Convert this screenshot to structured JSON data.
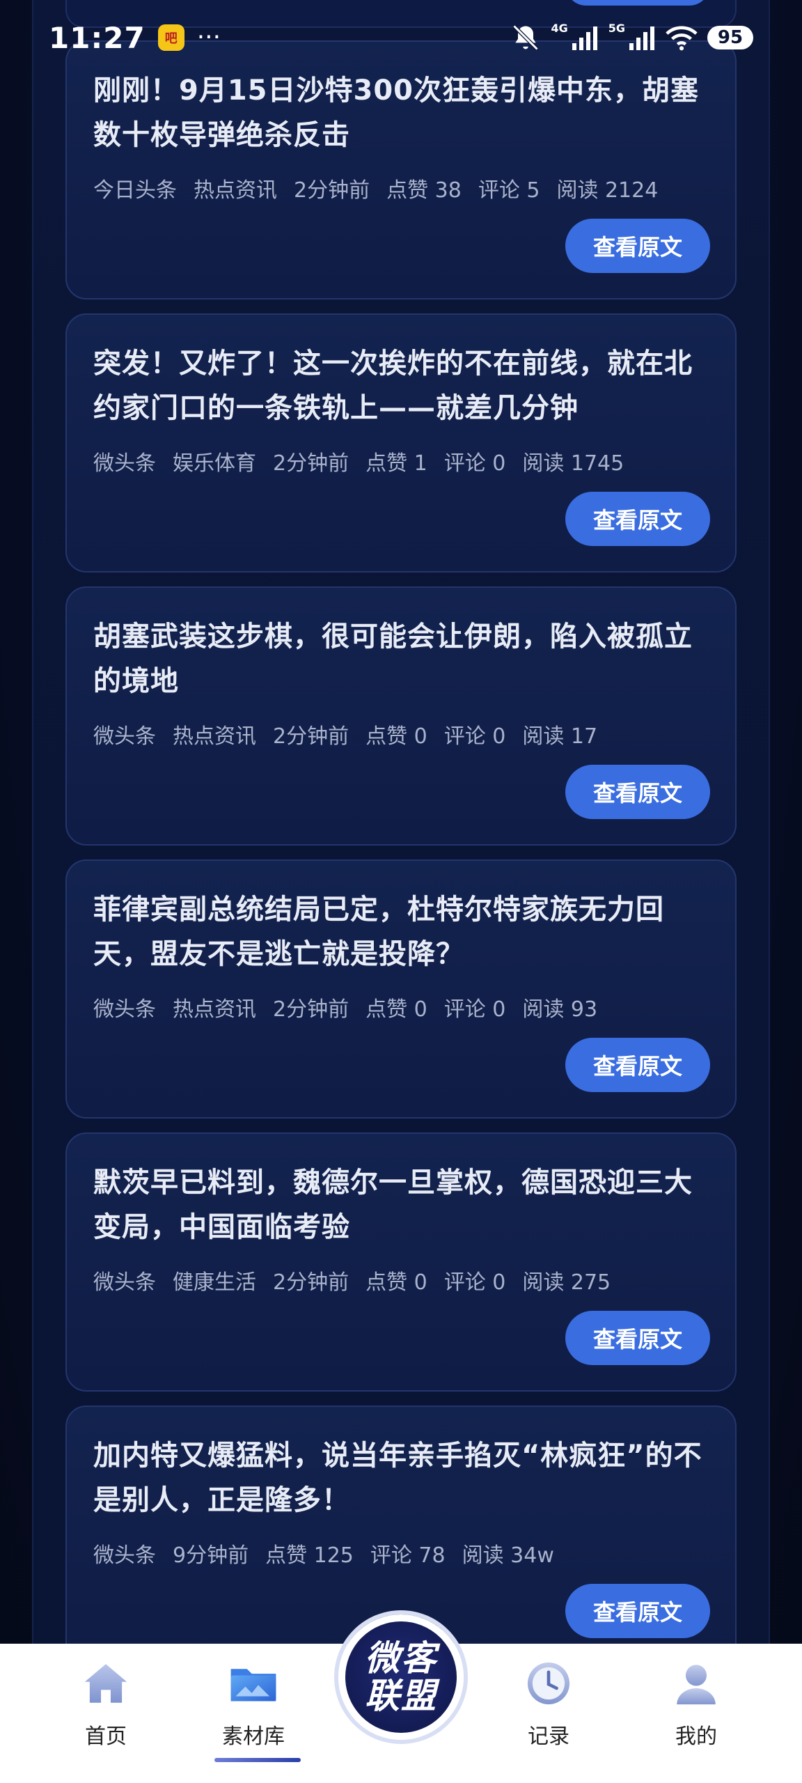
{
  "status_bar": {
    "time": "11:27",
    "app_badge": "吧",
    "overflow": "···",
    "net_4g": "4G",
    "net_5g": "5G",
    "battery": "95"
  },
  "cards": [
    {
      "title": "刚刚！9月15日沙特300次狂轰引爆中东，胡塞数十枚导弹绝杀反击",
      "meta": [
        "今日头条",
        "热点资讯",
        "2分钟前",
        "点赞 38",
        "评论 5",
        "阅读 2124"
      ],
      "button": "查看原文"
    },
    {
      "title": "突发！又炸了！这一次挨炸的不在前线，就在北约家门口的一条铁轨上——就差几分钟",
      "meta": [
        "微头条",
        "娱乐体育",
        "2分钟前",
        "点赞 1",
        "评论 0",
        "阅读 1745"
      ],
      "button": "查看原文"
    },
    {
      "title": "胡塞武装这步棋，很可能会让伊朗，陷入被孤立的境地",
      "meta": [
        "微头条",
        "热点资讯",
        "2分钟前",
        "点赞 0",
        "评论 0",
        "阅读 17"
      ],
      "button": "查看原文"
    },
    {
      "title": "菲律宾副总统结局已定，杜特尔特家族无力回天，盟友不是逃亡就是投降？",
      "meta": [
        "微头条",
        "热点资讯",
        "2分钟前",
        "点赞 0",
        "评论 0",
        "阅读 93"
      ],
      "button": "查看原文"
    },
    {
      "title": "默茨早已料到，魏德尔一旦掌权，德国恐迎三大变局，中国面临考验",
      "meta": [
        "微头条",
        "健康生活",
        "2分钟前",
        "点赞 0",
        "评论 0",
        "阅读 275"
      ],
      "button": "查看原文"
    },
    {
      "title": "加内特又爆猛料，说当年亲手掐灭“林疯狂”的不是别人，正是隆多！",
      "meta": [
        "微头条",
        "9分钟前",
        "点赞 125",
        "评论 78",
        "阅读 34w"
      ],
      "button": "查看原文"
    }
  ],
  "nav": {
    "items": [
      {
        "label": "首页",
        "icon": "home-icon"
      },
      {
        "label": "素材库",
        "icon": "folder-icon"
      },
      {
        "label": "记录",
        "icon": "clock-icon"
      },
      {
        "label": "我的",
        "icon": "user-icon"
      }
    ],
    "active_index": 1,
    "center": {
      "line1": "微客",
      "line2": "联盟"
    }
  },
  "colors": {
    "background": "#060b1e",
    "card": "#13234f",
    "accent_button": "#3a6de0",
    "nav_background": "#ffffff"
  }
}
